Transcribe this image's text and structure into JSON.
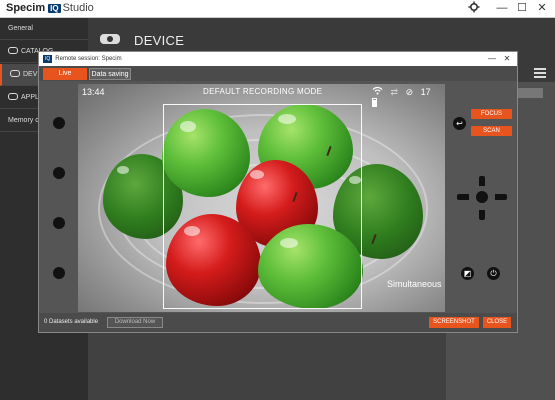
{
  "app": {
    "logo": "Specim",
    "logo_badge": "IQ",
    "logo_product": "Studio",
    "window_controls": {
      "minimize": "—",
      "maximize": "☐",
      "close": "✕"
    }
  },
  "sidebar": {
    "items": [
      {
        "label": "General"
      },
      {
        "label": "CATALOG"
      },
      {
        "label": "DEVICE"
      },
      {
        "label": "APPLIC"
      },
      {
        "label": "Memory ca"
      }
    ]
  },
  "main": {
    "title": "DEVICE"
  },
  "dialog": {
    "title_badge": "IQ",
    "title": "Remote session: Specim",
    "tabs": [
      {
        "label": "Live",
        "active": true
      },
      {
        "label": "Data saving",
        "active": false
      }
    ],
    "hud": {
      "time": "13:44",
      "mode": "DEFAULT RECORDING MODE",
      "counter": "17",
      "overlay_label": "Simultaneous"
    },
    "controls": {
      "focus_label": "FOCUS",
      "scan_label": "SCAN"
    },
    "footer": {
      "datasets_label": "0 Datasets available",
      "download_label": "Download Now",
      "screenshot_label": "SCREENSHOT",
      "close_label": "CLOSE"
    }
  },
  "colors": {
    "accent": "#e7541e",
    "brand_blue": "#0a3b6e",
    "dark_bg": "#3a3a3a"
  }
}
